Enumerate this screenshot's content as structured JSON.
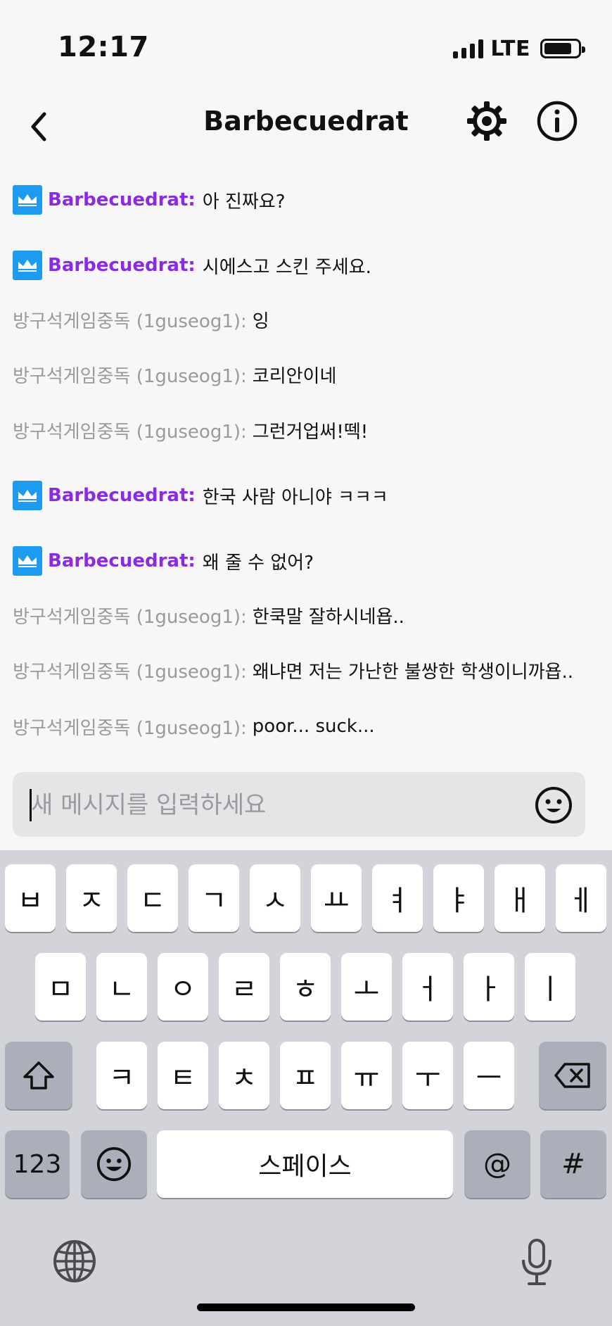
{
  "status_bar": {
    "time": "12:17",
    "network": "LTE"
  },
  "header": {
    "title": "Barbecuedrat"
  },
  "messages": [
    {
      "type": "mod",
      "user": "Barbecuedrat:",
      "text": "아 진짜요?"
    },
    {
      "type": "mod",
      "user": "Barbecuedrat:",
      "text": "시에스고 스킨 주세요."
    },
    {
      "type": "user",
      "user": "방구석게임중독 (1guseog1):",
      "text": "잉"
    },
    {
      "type": "user",
      "user": "방구석게임중독 (1guseog1):",
      "text": "코리안이네"
    },
    {
      "type": "user",
      "user": "방구석게임중독 (1guseog1):",
      "text": "그런거업써!떽!"
    },
    {
      "type": "mod",
      "user": "Barbecuedrat:",
      "text": "한국 사람 아니야 ㅋㅋㅋ"
    },
    {
      "type": "mod",
      "user": "Barbecuedrat:",
      "text": "왜 줄 수 없어?"
    },
    {
      "type": "user",
      "user": "방구석게임중독 (1guseog1):",
      "text": "한쿡말 잘하시네욥.."
    },
    {
      "type": "user",
      "user": "방구석게임중독 (1guseog1):",
      "text": "왜냐면 저는 가난한 불쌍한 학생이니까욥.."
    },
    {
      "type": "user",
      "user": "방구석게임중독 (1guseog1):",
      "text": "poor... suck..."
    }
  ],
  "input": {
    "placeholder": "새 메시지를 입력하세요"
  },
  "keyboard": {
    "row1": [
      "ㅂ",
      "ㅈ",
      "ㄷ",
      "ㄱ",
      "ㅅ",
      "ㅛ",
      "ㅕ",
      "ㅑ",
      "ㅐ",
      "ㅔ"
    ],
    "row2": [
      "ㅁ",
      "ㄴ",
      "ㅇ",
      "ㄹ",
      "ㅎ",
      "ㅗ",
      "ㅓ",
      "ㅏ",
      "ㅣ"
    ],
    "row3": [
      "ㅋ",
      "ㅌ",
      "ㅊ",
      "ㅍ",
      "ㅠ",
      "ㅜ",
      "ㅡ"
    ],
    "numbers_key": "123",
    "space_key": "스페이스",
    "at_key": "@",
    "hash_key": "#"
  },
  "colors": {
    "mod_name": "#8a2be2",
    "user_name": "#9a9a9a",
    "crown_badge": "#1d9bf0"
  },
  "icons": [
    "chevron-left-icon",
    "gear-icon",
    "info-icon",
    "crown-icon",
    "emoji-icon",
    "shift-icon",
    "backspace-icon",
    "globe-icon",
    "mic-icon"
  ]
}
